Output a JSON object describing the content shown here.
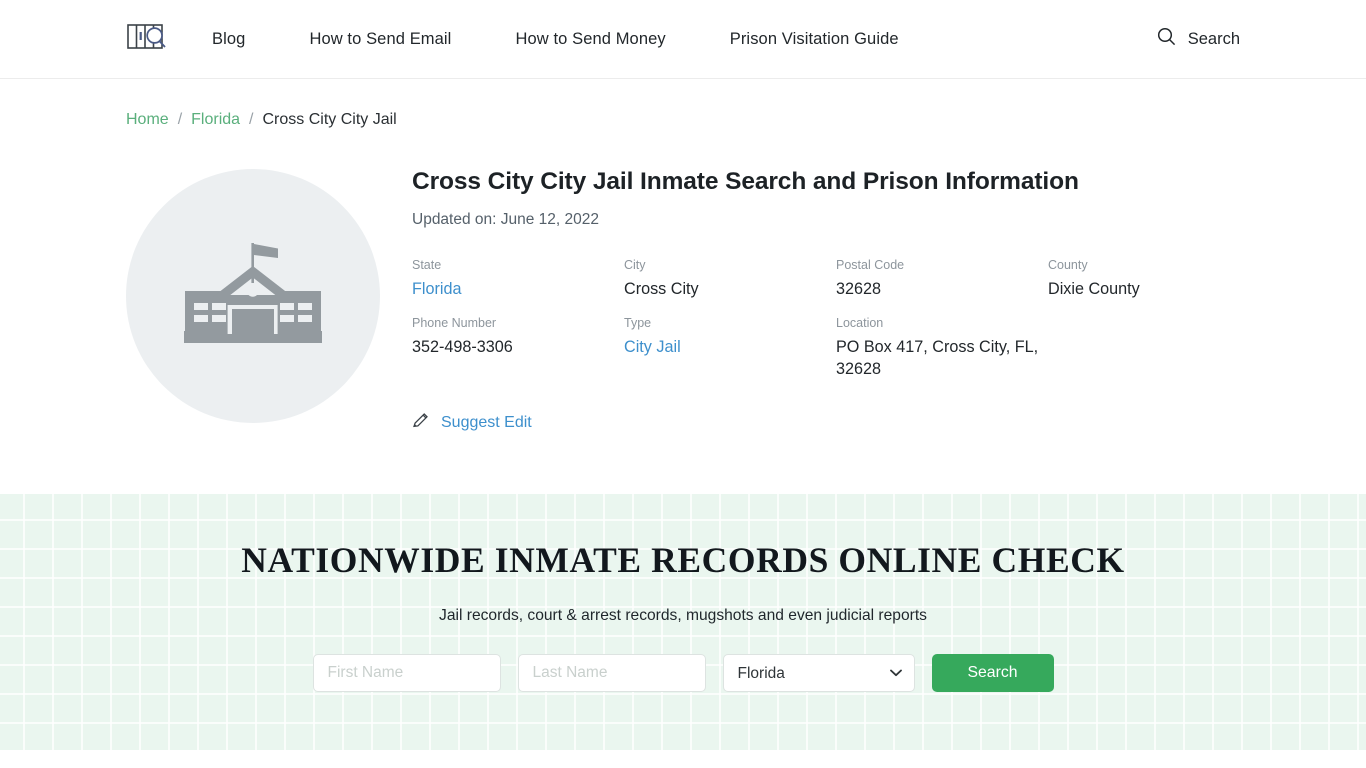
{
  "header": {
    "logo_icon": "jail-bars-search-logo",
    "nav": [
      {
        "label": "Blog"
      },
      {
        "label": "How to Send Email"
      },
      {
        "label": "How to Send Money"
      },
      {
        "label": "Prison Visitation Guide"
      }
    ],
    "search": {
      "icon": "search-icon",
      "label": "Search"
    }
  },
  "breadcrumb": {
    "home": "Home",
    "state": "Florida",
    "current": "Cross City City Jail",
    "separator": "/"
  },
  "facility": {
    "thumbnail_icon": "government-building-icon",
    "title": "Cross City City Jail Inmate Search and Prison Information",
    "updated": "Updated on: June 12, 2022",
    "fields": [
      {
        "label": "State",
        "value": "Florida",
        "link": true
      },
      {
        "label": "City",
        "value": "Cross City",
        "link": false
      },
      {
        "label": "Postal Code",
        "value": "32628",
        "link": false
      },
      {
        "label": "County",
        "value": "Dixie County",
        "link": false
      },
      {
        "label": "Phone Number",
        "value": "352-498-3306",
        "link": false
      },
      {
        "label": "Type",
        "value": "City Jail",
        "link": true
      },
      {
        "label": "Location",
        "value": "PO Box 417, Cross City, FL, 32628",
        "link": false
      }
    ],
    "suggest_edit": {
      "icon": "pencil-icon",
      "label": "Suggest Edit"
    }
  },
  "search_band": {
    "title": "NATIONWIDE INMATE RECORDS ONLINE CHECK",
    "subtitle": "Jail records, court & arrest records, mugshots and even judicial reports",
    "first_name": {
      "value": "",
      "placeholder": "First Name"
    },
    "last_name": {
      "value": "",
      "placeholder": "Last Name"
    },
    "state_select": {
      "selected": "Florida",
      "options": [
        "Florida"
      ],
      "chevron_icon": "chevron-down-icon"
    },
    "submit_label": "Search",
    "accent_color": "#36a95c",
    "background_color": "#eaf6ef"
  }
}
